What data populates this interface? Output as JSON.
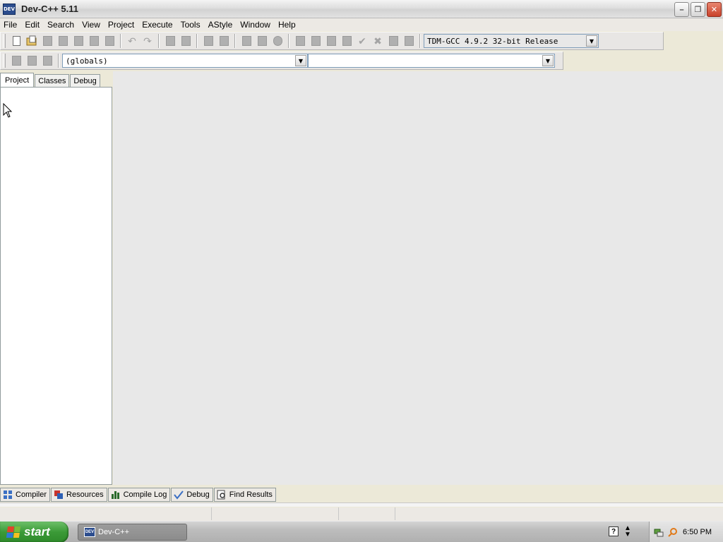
{
  "window": {
    "title": "Dev-C++ 5.11",
    "icon_label": "DEV",
    "buttons": [
      "minimize",
      "restore",
      "close"
    ]
  },
  "menu": [
    "File",
    "Edit",
    "Search",
    "View",
    "Project",
    "Execute",
    "Tools",
    "AStyle",
    "Window",
    "Help"
  ],
  "toolbar": {
    "compiler_select": "TDM-GCC 4.9.2 32-bit Release",
    "scope_select": "(globals)",
    "function_select": ""
  },
  "left_panel": {
    "tabs": [
      "Project",
      "Classes",
      "Debug"
    ],
    "active_tab": "Project"
  },
  "bottom_tabs": [
    "Compiler",
    "Resources",
    "Compile Log",
    "Debug",
    "Find Results"
  ],
  "taskbar": {
    "start_label": "start",
    "task_label": "Dev-C++",
    "clock": "6:50 PM",
    "help_glyph": "?"
  }
}
